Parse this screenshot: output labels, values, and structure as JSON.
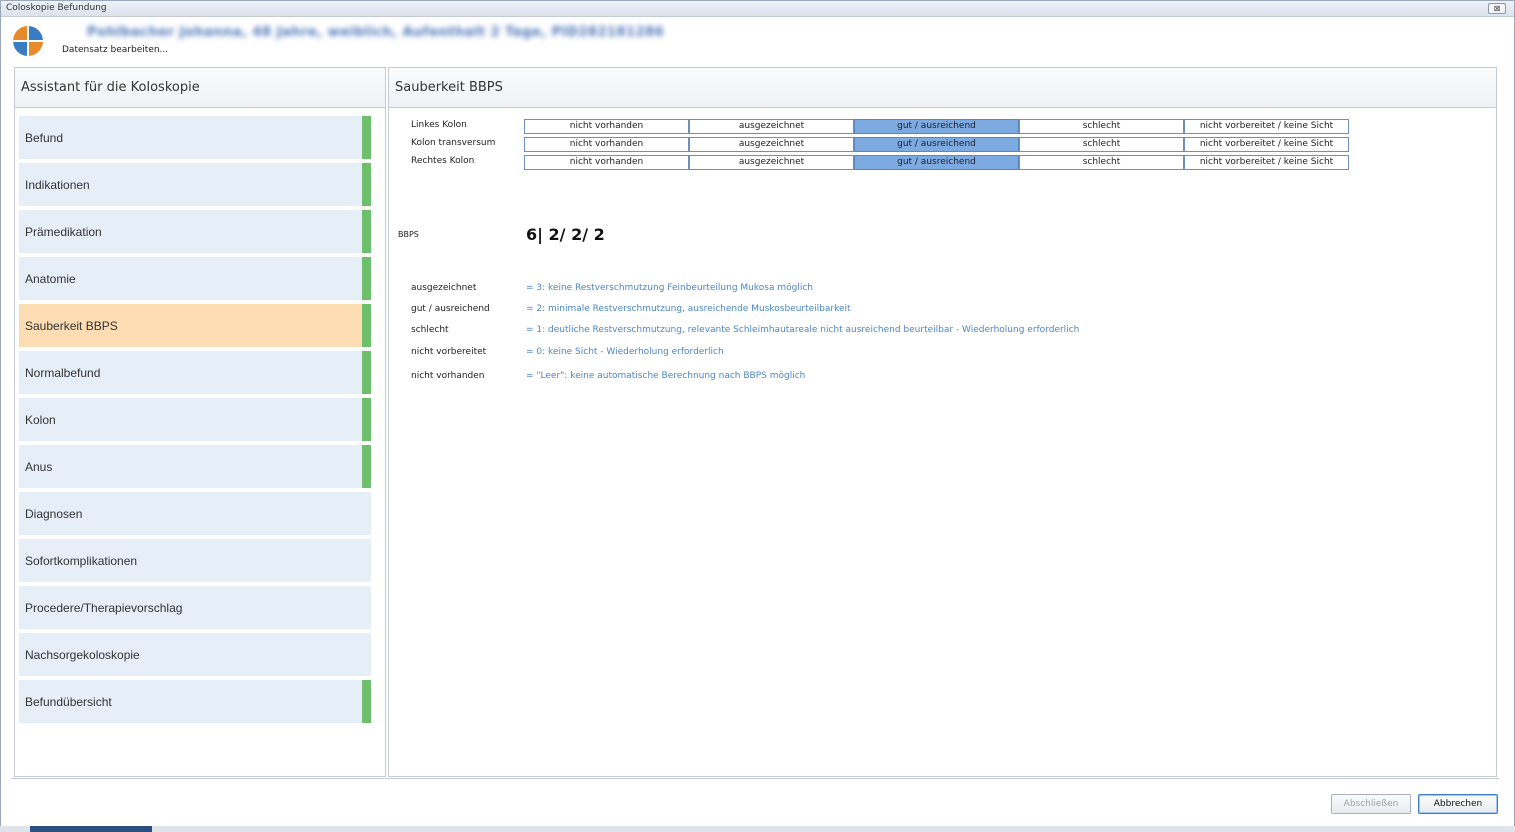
{
  "window": {
    "title": "Coloskopie Befundung",
    "close_glyph": "⊠"
  },
  "header": {
    "patient": "Pohlbacher Johanna, 48 Jahre, weiblich, Aufenthalt 2 Tage, PID282181286",
    "status": "Datensatz bearbeiten..."
  },
  "wizard": {
    "title": "Assistant für die Koloskopie",
    "steps": [
      {
        "label": "Befund",
        "complete": true
      },
      {
        "label": "Indikationen",
        "complete": true
      },
      {
        "label": "Prämedikation",
        "complete": true
      },
      {
        "label": "Anatomie",
        "complete": true
      },
      {
        "label": "Sauberkeit BBPS",
        "complete": true,
        "active": true
      },
      {
        "label": "Normalbefund",
        "complete": true
      },
      {
        "label": "Kolon",
        "complete": true
      },
      {
        "label": "Anus",
        "complete": true
      },
      {
        "label": "Diagnosen",
        "complete": false
      },
      {
        "label": "Sofortkomplikationen",
        "complete": false
      },
      {
        "label": "Procedere/Therapievorschlag",
        "complete": false
      },
      {
        "label": "Nachsorgekoloskopie",
        "complete": false
      },
      {
        "label": "Befundübersicht",
        "complete": true
      }
    ]
  },
  "detail": {
    "title": "Sauberkeit BBPS",
    "options": [
      "nicht vorhanden",
      "ausgezeichnet",
      "gut / ausreichend",
      "schlecht",
      "nicht vorbereitet / keine Sicht"
    ],
    "rows": [
      {
        "label": "Linkes Kolon",
        "selected": 2
      },
      {
        "label": "Kolon transversum",
        "selected": 2
      },
      {
        "label": "Rechtes Kolon",
        "selected": 2
      }
    ],
    "bbps_label": "BBPS",
    "bbps_value": "6| 2/ 2/ 2",
    "legend": [
      {
        "term": "ausgezeichnet",
        "desc": "= 3: keine Restverschmutzung Feinbeurteilung Mukosa möglich"
      },
      {
        "term": "gut / ausreichend",
        "desc": "= 2: minimale Restverschmutzung, ausreichende Muskosbeurteilbarkeit"
      },
      {
        "term": "schlecht",
        "desc": "= 1: deutliche Restverschmutzung, relevante Schleimhautareale nicht ausreichend beurteilbar - Wiederholung erforderlich"
      },
      {
        "term": "nicht vorbereitet",
        "desc": "= 0: keine Sicht - Wiederholung erforderlich"
      },
      {
        "term": "nicht vorhanden",
        "desc": "= \"Leer\": keine automatische Berechnung nach BBPS möglich"
      }
    ]
  },
  "buttons": {
    "finish": "Abschließen",
    "cancel": "Abbrechen"
  },
  "colors": {
    "selected": "#7eaae2",
    "active_step": "#fcdcb2",
    "step": "#e6eef8",
    "complete_mark": "#6dbf6b",
    "legend_text": "#4a86c8"
  }
}
